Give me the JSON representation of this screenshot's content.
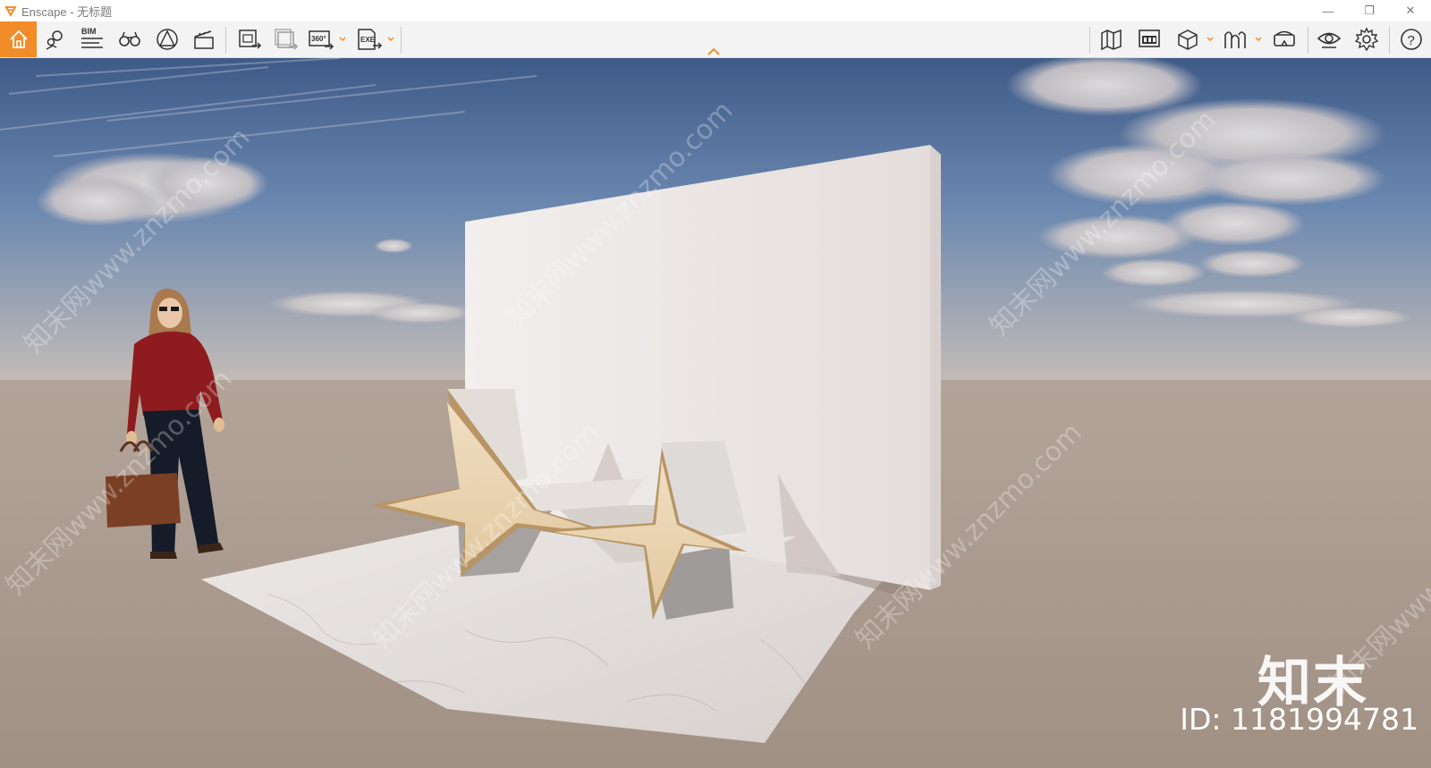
{
  "window": {
    "title": "Enscape - 无标题",
    "minimize_glyph": "—",
    "restore_glyph": "❐",
    "close_glyph": "✕"
  },
  "toolbar": {
    "left_icons": [
      "home-icon",
      "location-pins-icon",
      "bim-icon",
      "binoculars-icon",
      "safe-frame-icon",
      "video-clapper-icon"
    ],
    "export_icons": [
      "render-image-icon",
      "batch-render-icon",
      "panorama-360-icon",
      "exe-export-icon"
    ],
    "bim_label": "BIM",
    "pano_label": "360°",
    "exe_label": "EXE",
    "right_icons": [
      "map-icon",
      "views-icon",
      "asset-library-icon",
      "material-editor-icon",
      "vr-headset-icon",
      "visual-settings-icon",
      "settings-icon",
      "help-icon"
    ],
    "help_glyph": "?",
    "accent_color": "#f28c28"
  },
  "viewport": {
    "brand_logo": "知末",
    "image_id": "ID: 1181994781",
    "watermark_text": "知末网www.znzmo.com"
  }
}
